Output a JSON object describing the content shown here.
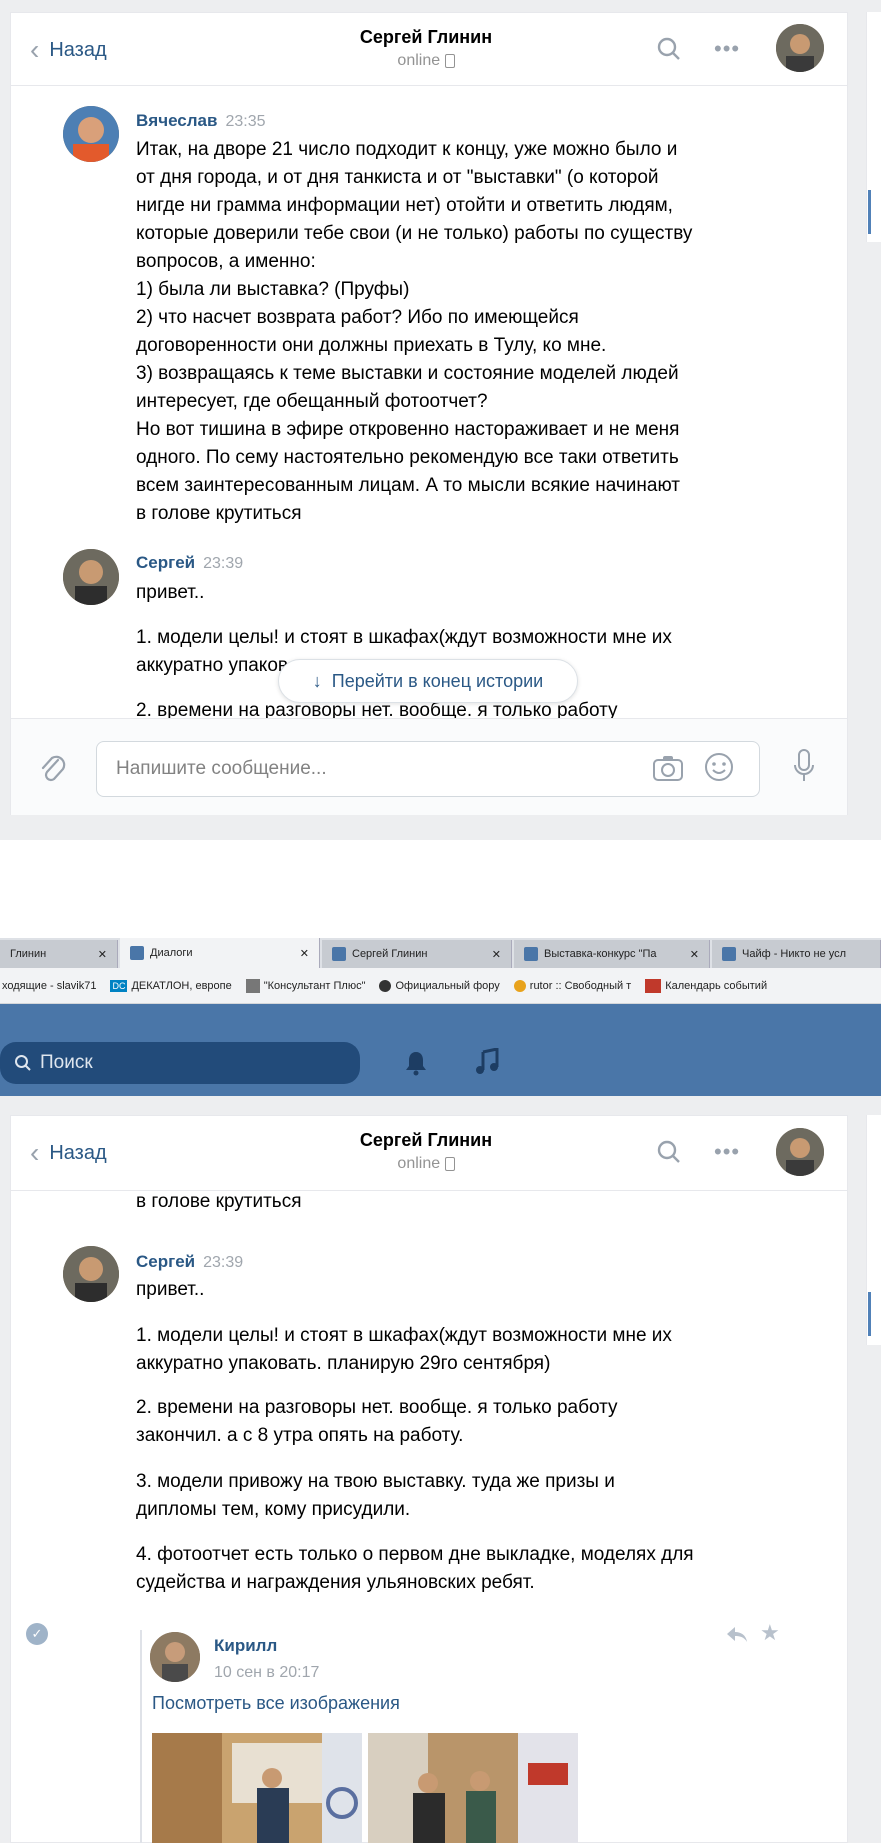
{
  "top": {
    "header": {
      "back": "Назад",
      "name": "Сергей Глинин",
      "status": "online"
    },
    "messages": [
      {
        "author": "Вячеслав",
        "time": "23:35",
        "text": "Итак, на дворе 21 число подходит к концу, уже можно было и\nот дня города, и от дня танкиста и от \"выставки\" (о которой\nнигде ни грамма информации нет) отойти и ответить людям,\nкоторые доверили тебе свои (и не только) работы по существу\nвопросов, а именно:\n1) была ли выставка? (Пруфы)\n2) что насчет возврата работ? Ибо по имеющейся\nдоговоренности они должны приехать в Тулу, ко мне.\n3) возвращаясь к теме выставки и состояние моделей людей\nинтересует, где обещанный фотоотчет?\nНо вот тишина в эфире откровенно настораживает и не меня\nодного. По сему настоятельно рекомендую все таки ответить\nвсем заинтересованным лицам. А то мысли всякие начинают\nв голове крутиться"
      },
      {
        "author": "Сергей",
        "time": "23:39",
        "text": "привет.."
      }
    ],
    "para1_line1": "1. модели целы! и стоят в шкафах(ждут возможности мне их",
    "para1_line2": "аккуратно упаков",
    "para2_line1": "2. времени на разговоры нет. вообще. я только работу",
    "jump_label": "Перейти в конец истории",
    "input_placeholder": "Напишите сообщение..."
  },
  "browser": {
    "tabs": [
      "Глинин",
      "Диалоги",
      "Сергей Глинин",
      "Выставка-конкурс \"Па",
      "Чайф - Никто не усл"
    ],
    "bookmarks": [
      "ходящие - slavik71",
      "ДЕКАТЛОН, европе",
      "\"Консультант Плюс\"",
      "Официальный фору",
      "rutor :: Свободный т",
      "Календарь событий"
    ],
    "search_placeholder": "Поиск"
  },
  "bottom": {
    "header": {
      "back": "Назад",
      "name": "Сергей Глинин",
      "status": "online"
    },
    "cut_line": "в голове крутиться",
    "message": {
      "author": "Сергей",
      "time": "23:39",
      "greeting": "привет..",
      "paragraphs": [
        "1. модели целы! и стоят в шкафах(ждут возможности мне их\nаккуратно упаковать. планирую 29го сентября)",
        "2. времени на разговоры нет. вообще. я только работу\nзакончил. а с 8 утра опять на работу.",
        "3. модели привожу на твою выставку. туда же призы и\nдипломы тем, кому присудили.",
        "4. фотоотчет есть только о первом дне выкладке, моделях для\nсудейства и награждения ульяновских ребят."
      ]
    },
    "forward": {
      "author": "Кирилл",
      "date": "10 сен в 20:17",
      "link": "Посмотреть все изображения"
    }
  },
  "colors": {
    "accent": "#2a5885",
    "vk_blue": "#4a76a8"
  }
}
